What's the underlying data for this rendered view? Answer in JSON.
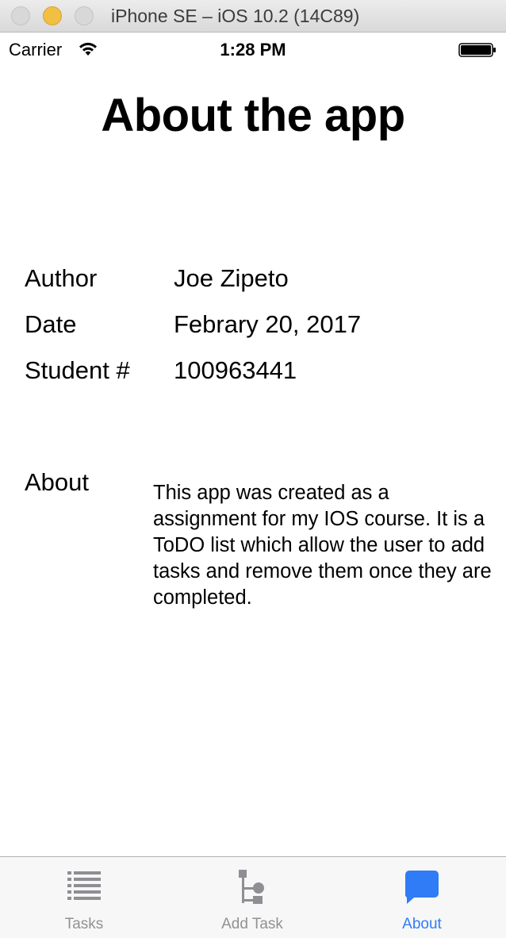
{
  "window": {
    "title": "iPhone SE – iOS 10.2 (14C89)"
  },
  "status_bar": {
    "carrier": "Carrier",
    "time": "1:28 PM"
  },
  "page": {
    "title": "About the app",
    "info": [
      {
        "label": "Author",
        "value": "Joe Zipeto"
      },
      {
        "label": "Date",
        "value": "Febrary 20, 2017"
      },
      {
        "label": "Student #",
        "value": "100963441"
      }
    ],
    "about_label": "About",
    "about_text": "This app was created as a assignment for my IOS course. It is a ToDO list which allow the user to add tasks and remove them once they are completed."
  },
  "tab_bar": {
    "tabs": [
      {
        "label": "Tasks",
        "icon": "list-icon"
      },
      {
        "label": "Add Task",
        "icon": "hierarchy-icon"
      },
      {
        "label": "About",
        "icon": "speech-bubble-icon"
      }
    ],
    "selected": "About",
    "active_color": "#2f7cf6",
    "inactive_color": "#929292"
  }
}
